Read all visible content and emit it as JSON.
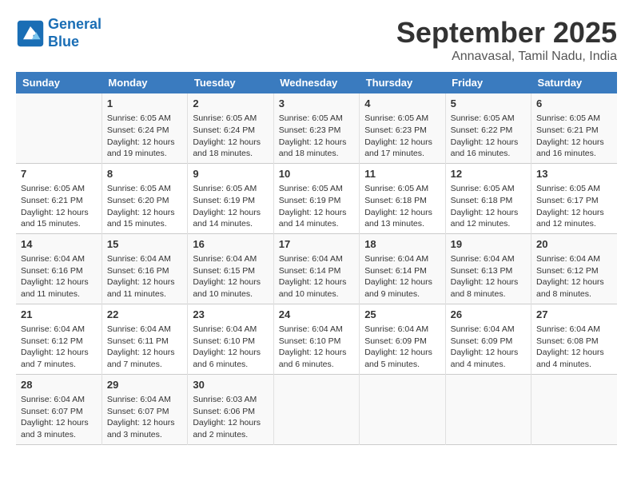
{
  "header": {
    "logo_line1": "General",
    "logo_line2": "Blue",
    "month": "September 2025",
    "location": "Annavasal, Tamil Nadu, India"
  },
  "days_of_week": [
    "Sunday",
    "Monday",
    "Tuesday",
    "Wednesday",
    "Thursday",
    "Friday",
    "Saturday"
  ],
  "weeks": [
    [
      {
        "day": "",
        "info": ""
      },
      {
        "day": "1",
        "info": "Sunrise: 6:05 AM\nSunset: 6:24 PM\nDaylight: 12 hours\nand 19 minutes."
      },
      {
        "day": "2",
        "info": "Sunrise: 6:05 AM\nSunset: 6:24 PM\nDaylight: 12 hours\nand 18 minutes."
      },
      {
        "day": "3",
        "info": "Sunrise: 6:05 AM\nSunset: 6:23 PM\nDaylight: 12 hours\nand 18 minutes."
      },
      {
        "day": "4",
        "info": "Sunrise: 6:05 AM\nSunset: 6:23 PM\nDaylight: 12 hours\nand 17 minutes."
      },
      {
        "day": "5",
        "info": "Sunrise: 6:05 AM\nSunset: 6:22 PM\nDaylight: 12 hours\nand 16 minutes."
      },
      {
        "day": "6",
        "info": "Sunrise: 6:05 AM\nSunset: 6:21 PM\nDaylight: 12 hours\nand 16 minutes."
      }
    ],
    [
      {
        "day": "7",
        "info": "Sunrise: 6:05 AM\nSunset: 6:21 PM\nDaylight: 12 hours\nand 15 minutes."
      },
      {
        "day": "8",
        "info": "Sunrise: 6:05 AM\nSunset: 6:20 PM\nDaylight: 12 hours\nand 15 minutes."
      },
      {
        "day": "9",
        "info": "Sunrise: 6:05 AM\nSunset: 6:19 PM\nDaylight: 12 hours\nand 14 minutes."
      },
      {
        "day": "10",
        "info": "Sunrise: 6:05 AM\nSunset: 6:19 PM\nDaylight: 12 hours\nand 14 minutes."
      },
      {
        "day": "11",
        "info": "Sunrise: 6:05 AM\nSunset: 6:18 PM\nDaylight: 12 hours\nand 13 minutes."
      },
      {
        "day": "12",
        "info": "Sunrise: 6:05 AM\nSunset: 6:18 PM\nDaylight: 12 hours\nand 12 minutes."
      },
      {
        "day": "13",
        "info": "Sunrise: 6:05 AM\nSunset: 6:17 PM\nDaylight: 12 hours\nand 12 minutes."
      }
    ],
    [
      {
        "day": "14",
        "info": "Sunrise: 6:04 AM\nSunset: 6:16 PM\nDaylight: 12 hours\nand 11 minutes."
      },
      {
        "day": "15",
        "info": "Sunrise: 6:04 AM\nSunset: 6:16 PM\nDaylight: 12 hours\nand 11 minutes."
      },
      {
        "day": "16",
        "info": "Sunrise: 6:04 AM\nSunset: 6:15 PM\nDaylight: 12 hours\nand 10 minutes."
      },
      {
        "day": "17",
        "info": "Sunrise: 6:04 AM\nSunset: 6:14 PM\nDaylight: 12 hours\nand 10 minutes."
      },
      {
        "day": "18",
        "info": "Sunrise: 6:04 AM\nSunset: 6:14 PM\nDaylight: 12 hours\nand 9 minutes."
      },
      {
        "day": "19",
        "info": "Sunrise: 6:04 AM\nSunset: 6:13 PM\nDaylight: 12 hours\nand 8 minutes."
      },
      {
        "day": "20",
        "info": "Sunrise: 6:04 AM\nSunset: 6:12 PM\nDaylight: 12 hours\nand 8 minutes."
      }
    ],
    [
      {
        "day": "21",
        "info": "Sunrise: 6:04 AM\nSunset: 6:12 PM\nDaylight: 12 hours\nand 7 minutes."
      },
      {
        "day": "22",
        "info": "Sunrise: 6:04 AM\nSunset: 6:11 PM\nDaylight: 12 hours\nand 7 minutes."
      },
      {
        "day": "23",
        "info": "Sunrise: 6:04 AM\nSunset: 6:10 PM\nDaylight: 12 hours\nand 6 minutes."
      },
      {
        "day": "24",
        "info": "Sunrise: 6:04 AM\nSunset: 6:10 PM\nDaylight: 12 hours\nand 6 minutes."
      },
      {
        "day": "25",
        "info": "Sunrise: 6:04 AM\nSunset: 6:09 PM\nDaylight: 12 hours\nand 5 minutes."
      },
      {
        "day": "26",
        "info": "Sunrise: 6:04 AM\nSunset: 6:09 PM\nDaylight: 12 hours\nand 4 minutes."
      },
      {
        "day": "27",
        "info": "Sunrise: 6:04 AM\nSunset: 6:08 PM\nDaylight: 12 hours\nand 4 minutes."
      }
    ],
    [
      {
        "day": "28",
        "info": "Sunrise: 6:04 AM\nSunset: 6:07 PM\nDaylight: 12 hours\nand 3 minutes."
      },
      {
        "day": "29",
        "info": "Sunrise: 6:04 AM\nSunset: 6:07 PM\nDaylight: 12 hours\nand 3 minutes."
      },
      {
        "day": "30",
        "info": "Sunrise: 6:03 AM\nSunset: 6:06 PM\nDaylight: 12 hours\nand 2 minutes."
      },
      {
        "day": "",
        "info": ""
      },
      {
        "day": "",
        "info": ""
      },
      {
        "day": "",
        "info": ""
      },
      {
        "day": "",
        "info": ""
      }
    ]
  ]
}
